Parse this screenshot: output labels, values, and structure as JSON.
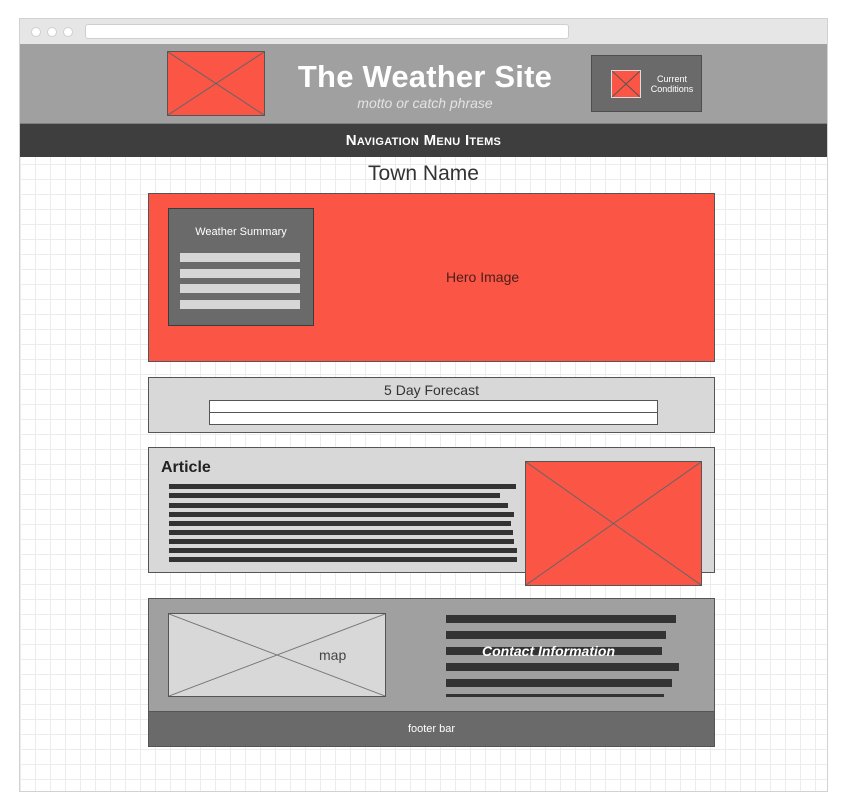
{
  "header": {
    "site_title": "The Weather Site",
    "motto": "motto or catch phrase",
    "current_conditions": "Current Conditions"
  },
  "nav": {
    "label": "Navigation Menu Items"
  },
  "town": {
    "name": "Town Name"
  },
  "hero": {
    "label": "Hero Image",
    "summary_title": "Weather Summary"
  },
  "forecast": {
    "title": "5 Day Forecast"
  },
  "article": {
    "title": "Article"
  },
  "bottom": {
    "map_label": "map",
    "contact_label": "Contact Information",
    "footer_label": "footer bar"
  },
  "colors": {
    "accent": "#fa5545",
    "header_bg": "#a0a0a0",
    "nav_bg": "#3e3e3e",
    "panel_bg": "#d8d8d8",
    "dark_box": "#6a6a6a"
  }
}
